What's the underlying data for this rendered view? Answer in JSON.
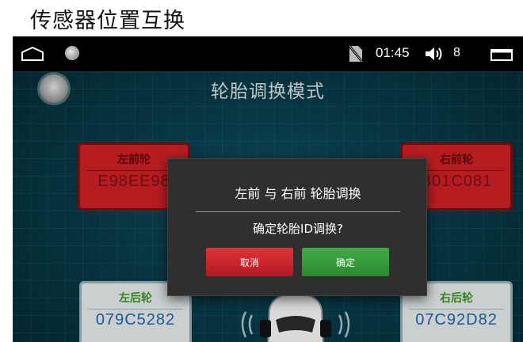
{
  "caption": "传感器位置互换",
  "status_bar": {
    "time": "01:45",
    "volume_level": "8",
    "icons": [
      "home-icon",
      "app-icon",
      "no-sim-icon",
      "volume-icon",
      "window-icon"
    ]
  },
  "screen": {
    "title": "轮胎调换模式"
  },
  "tires": {
    "front_left": {
      "name": "左前轮",
      "id": "E98EE98",
      "status": "alert"
    },
    "front_right": {
      "name": "右前轮",
      "id": "B01C081",
      "status": "alert"
    },
    "rear_left": {
      "name": "左后轮",
      "id": "079C5282",
      "status": "normal"
    },
    "rear_right": {
      "name": "右后轮",
      "id": "07C92D82",
      "status": "normal"
    }
  },
  "dialog": {
    "title": "左前 与 右前 轮胎调换",
    "message": "确定轮胎ID调换?",
    "cancel_label": "取消",
    "confirm_label": "确定"
  },
  "colors": {
    "alert_card": "#c21f24",
    "normal_card": "#d7dcdd",
    "cancel_button": "#d2262d",
    "confirm_button": "#3a9c3e",
    "background": "#083845"
  }
}
